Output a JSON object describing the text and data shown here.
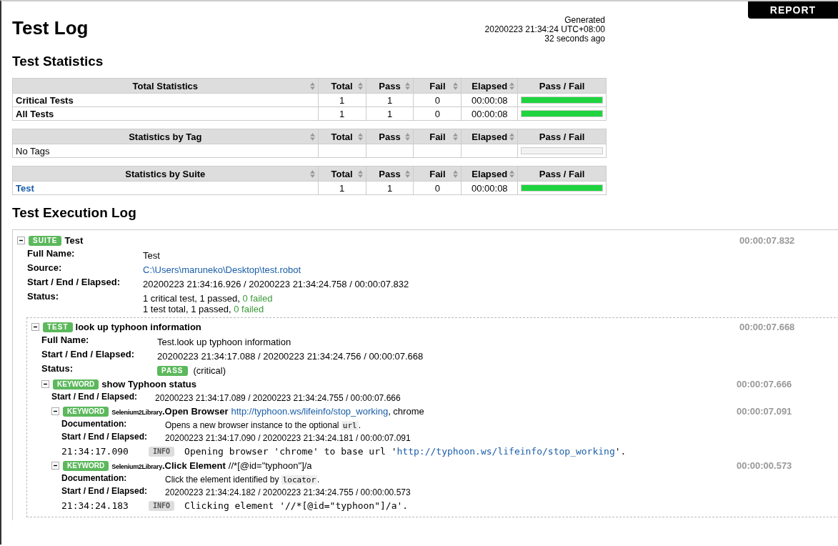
{
  "header": {
    "title": "Test Log",
    "generated": [
      "Generated",
      "20200223 21:34:24 UTC+08:00",
      "32 seconds ago"
    ],
    "report_link": "REPORT"
  },
  "statistics": {
    "title": "Test Statistics",
    "tables": [
      {
        "columns": [
          "Total Statistics",
          "Total",
          "Pass",
          "Fail",
          "Elapsed",
          "Pass / Fail"
        ],
        "rows": [
          {
            "kind": "bold",
            "name": "Critical Tests",
            "total": "1",
            "pass": "1",
            "fail": "0",
            "elapsed": "00:00:08",
            "level": 1
          },
          {
            "kind": "bold",
            "name": "All Tests",
            "total": "1",
            "pass": "1",
            "fail": "0",
            "elapsed": "00:00:08",
            "level": 1
          }
        ]
      },
      {
        "columns": [
          "Statistics by Tag",
          "Total",
          "Pass",
          "Fail",
          "Elapsed",
          "Pass / Fail"
        ],
        "rows": [
          {
            "kind": "plain",
            "name": "No Tags"
          }
        ]
      },
      {
        "columns": [
          "Statistics by Suite",
          "Total",
          "Pass",
          "Fail",
          "Elapsed",
          "Pass / Fail"
        ],
        "rows": [
          {
            "kind": "link",
            "name": "Test",
            "total": "1",
            "pass": "1",
            "fail": "0",
            "elapsed": "00:00:08",
            "level": 1
          }
        ]
      }
    ]
  },
  "execution_log": {
    "title": "Test Execution Log",
    "root": {
      "kind": "suite",
      "badge": "SUITE",
      "expanded": true,
      "elapsed": "00:00:07.832",
      "name_parts": [
        {
          "kind": "name",
          "text": "Test"
        }
      ],
      "fields": [
        {
          "label": "Full Name:",
          "parts": [
            {
              "kind": "text",
              "text": "Test"
            }
          ]
        },
        {
          "label": "Source:",
          "parts": [
            {
              "kind": "link",
              "text": "C:\\Users\\maruneko\\Desktop\\test.robot"
            }
          ]
        },
        {
          "label": "Start / End / Elapsed:",
          "parts": [
            {
              "kind": "text",
              "text": "20200223 21:34:16.926 / 20200223 21:34:24.758 / 00:00:07.832"
            }
          ]
        },
        {
          "label": "Status:",
          "parts": [
            {
              "kind": "text",
              "text": "1 critical test, 1 passed, "
            },
            {
              "kind": "green",
              "text": "0 failed"
            },
            {
              "kind": "break"
            },
            {
              "kind": "text",
              "text": "1 test total, 1 passed, "
            },
            {
              "kind": "green",
              "text": "0 failed"
            }
          ]
        }
      ],
      "children": [
        {
          "kind": "test",
          "badge": "TEST",
          "expanded": true,
          "elapsed": "00:00:07.668",
          "name_parts": [
            {
              "kind": "name",
              "text": "look up typhoon information"
            }
          ],
          "fields": [
            {
              "label": "Full Name:",
              "parts": [
                {
                  "kind": "text",
                  "text": "Test.look up typhoon information"
                }
              ]
            },
            {
              "label": "Start / End / Elapsed:",
              "parts": [
                {
                  "kind": "text",
                  "text": "20200223 21:34:17.088 / 20200223 21:34:24.756 / 00:00:07.668"
                }
              ]
            },
            {
              "label": "Status:",
              "parts": [
                {
                  "kind": "badge",
                  "text": "PASS"
                },
                {
                  "kind": "text",
                  "text": "(critical)"
                }
              ]
            }
          ],
          "children": [
            {
              "kind": "keyword",
              "badge": "KEYWORD",
              "expanded": true,
              "elapsed": "00:00:07.666",
              "name_parts": [
                {
                  "kind": "name",
                  "text": "show Typhoon status"
                }
              ],
              "fields": [
                {
                  "label": "Start / End / Elapsed:",
                  "parts": [
                    {
                      "kind": "text",
                      "text": "20200223 21:34:17.089 / 20200223 21:34:24.755 / 00:00:07.666"
                    }
                  ]
                }
              ],
              "children": [
                {
                  "kind": "keyword",
                  "badge": "KEYWORD",
                  "expanded": true,
                  "elapsed": "00:00:07.091",
                  "name_parts": [
                    {
                      "kind": "library",
                      "text": "Selenium2Library"
                    },
                    {
                      "kind": "name",
                      "text": ".Open Browser"
                    },
                    {
                      "kind": "link",
                      "text": "http://typhoon.ws/lifeinfo/stop_working"
                    },
                    {
                      "kind": "arg",
                      "text": ", chrome"
                    }
                  ],
                  "fields": [
                    {
                      "label": "Documentation:",
                      "parts": [
                        {
                          "kind": "text",
                          "text": "Opens a new browser instance to the optional "
                        },
                        {
                          "kind": "code",
                          "text": "url"
                        },
                        {
                          "kind": "text",
                          "text": "."
                        }
                      ]
                    },
                    {
                      "label": "Start / End / Elapsed:",
                      "parts": [
                        {
                          "kind": "text",
                          "text": "20200223 21:34:17.090 / 20200223 21:34:24.181 / 00:00:07.091"
                        }
                      ]
                    }
                  ],
                  "messages": [
                    {
                      "time": "21:34:17.090",
                      "level": "INFO",
                      "parts": [
                        {
                          "kind": "text",
                          "text": "Opening browser 'chrome' to base url '"
                        },
                        {
                          "kind": "link",
                          "text": "http://typhoon.ws/lifeinfo/stop_working"
                        },
                        {
                          "kind": "text",
                          "text": "'."
                        }
                      ]
                    }
                  ]
                },
                {
                  "kind": "keyword",
                  "badge": "KEYWORD",
                  "expanded": true,
                  "elapsed": "00:00:00.573",
                  "name_parts": [
                    {
                      "kind": "library",
                      "text": "Selenium2Library"
                    },
                    {
                      "kind": "name",
                      "text": ".Click Element"
                    },
                    {
                      "kind": "arg",
                      "text": "//*[@id=\"typhoon\"]/a"
                    }
                  ],
                  "fields": [
                    {
                      "label": "Documentation:",
                      "parts": [
                        {
                          "kind": "text",
                          "text": "Click the element identified by "
                        },
                        {
                          "kind": "code",
                          "text": "locator"
                        },
                        {
                          "kind": "text",
                          "text": "."
                        }
                      ]
                    },
                    {
                      "label": "Start / End / Elapsed:",
                      "parts": [
                        {
                          "kind": "text",
                          "text": "20200223 21:34:24.182 / 20200223 21:34:24.755 / 00:00:00.573"
                        }
                      ]
                    }
                  ],
                  "messages": [
                    {
                      "time": "21:34:24.183",
                      "level": "INFO",
                      "parts": [
                        {
                          "kind": "text",
                          "text": "Clicking element '//*[@id=\"typhoon\"]/a'."
                        }
                      ]
                    }
                  ]
                }
              ]
            }
          ]
        }
      ]
    }
  }
}
